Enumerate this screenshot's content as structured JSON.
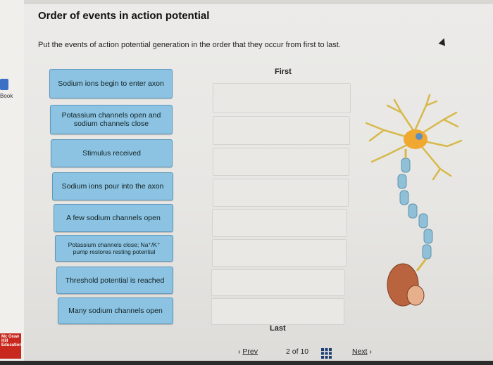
{
  "page": {
    "title": "Order of events in action potential",
    "instructions": "Put the events of action potential generation in the order that they occur from first to last.",
    "first_label": "First",
    "last_label": "Last",
    "ebook_label": "Book"
  },
  "items": [
    {
      "label": "Sodium ions begin to enter axon"
    },
    {
      "label": "Potassium channels open and sodium channels close"
    },
    {
      "label": "Stimulus received"
    },
    {
      "label": "Sodium ions pour into the axon"
    },
    {
      "label": "A few sodium channels open"
    },
    {
      "label": "Potassium channels close; Na⁺/K⁺ pump restores resting potential"
    },
    {
      "label": "Threshold potential is reached"
    },
    {
      "label": "Many sodium channels open"
    }
  ],
  "nav": {
    "prev": "Prev",
    "page_current": "2",
    "page_of": "of",
    "page_total": "10",
    "next": "Next"
  },
  "logo_text": "Mc Graw Hill Education",
  "colors": {
    "chip": "#8cc3e3",
    "chip_border": "#5d97bb",
    "logo": "#c8281e"
  }
}
